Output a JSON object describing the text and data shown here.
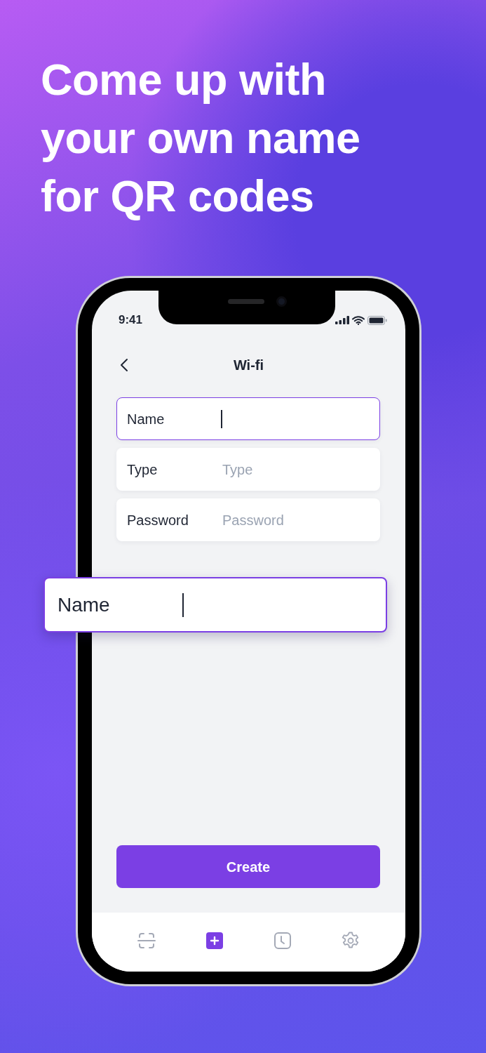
{
  "headline": "Come up with your own name for QR codes",
  "status_bar": {
    "time": "9:41"
  },
  "nav": {
    "title": "Wi-fi"
  },
  "fields": [
    {
      "label": "Name",
      "focused": true
    },
    {
      "label": "Type",
      "placeholder": "Type",
      "focused": false
    },
    {
      "label": "Password",
      "placeholder": "Password",
      "focused": false
    }
  ],
  "callout": {
    "label": "Name",
    "focused": true
  },
  "create_button": "Create",
  "tab_bar": [
    {
      "kind": "scan",
      "selected": false
    },
    {
      "kind": "add",
      "selected": true
    },
    {
      "kind": "history",
      "selected": false
    },
    {
      "kind": "settings",
      "selected": false
    }
  ]
}
